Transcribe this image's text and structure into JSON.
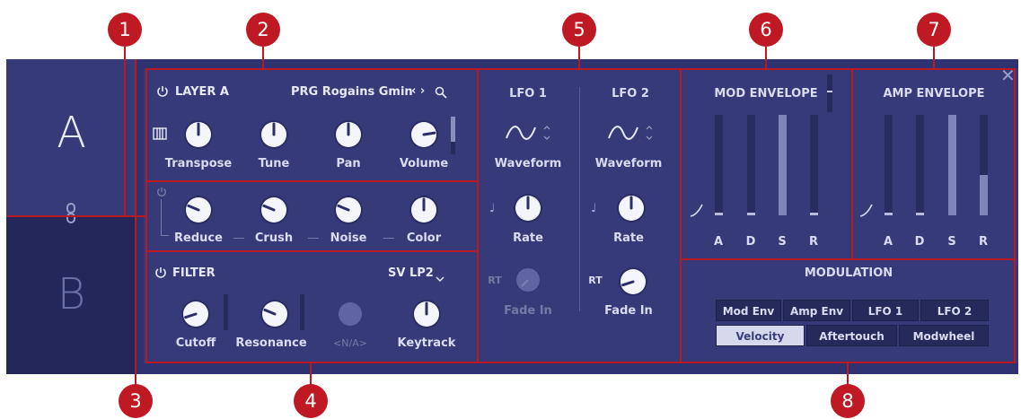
{
  "layers": {
    "a_label": "A",
    "b_label": "B"
  },
  "close_glyph": "✕",
  "callouts": [
    "1",
    "2",
    "3",
    "4",
    "5",
    "6",
    "7",
    "8"
  ],
  "layer_panel": {
    "title": "LAYER A",
    "preset": "PRG Rogains Gmin",
    "knobs": [
      {
        "label": "Transpose",
        "value": 0.5
      },
      {
        "label": "Tune",
        "value": 0.5
      },
      {
        "label": "Pan",
        "value": 0.5
      },
      {
        "label": "Volume",
        "value": 0.8
      }
    ]
  },
  "fx_panel": {
    "knobs": [
      {
        "label": "Reduce",
        "value": 0.25
      },
      {
        "label": "Crush",
        "value": 0.25
      },
      {
        "label": "Noise",
        "value": 0.25
      },
      {
        "label": "Color",
        "value": 0.5
      }
    ]
  },
  "filter_panel": {
    "title": "FILTER",
    "type": "SV LP2",
    "knobs": [
      {
        "label": "Cutoff",
        "value": 0.1
      },
      {
        "label": "Resonance",
        "value": 0.25
      },
      {
        "label": "<N/A>",
        "value": 0.0
      },
      {
        "label": "Keytrack",
        "value": 0.5
      }
    ]
  },
  "lfo1": {
    "title": "LFO 1",
    "waveform_label": "Waveform",
    "rate_label": "Rate",
    "rt_label": "RT",
    "fade_label": "Fade In"
  },
  "lfo2": {
    "title": "LFO 2",
    "waveform_label": "Waveform",
    "rate_label": "Rate",
    "rt_label": "RT",
    "fade_label": "Fade In"
  },
  "mod_env": {
    "title": "MOD ENVELOPE",
    "labels": [
      "A",
      "D",
      "S",
      "R"
    ],
    "levels": [
      0.0,
      0.0,
      1.0,
      0.0
    ]
  },
  "amp_env": {
    "title": "AMP ENVELOPE",
    "labels": [
      "A",
      "D",
      "S",
      "R"
    ],
    "levels": [
      0.0,
      0.0,
      1.0,
      0.4
    ]
  },
  "modulation": {
    "title": "MODULATION",
    "row1": [
      "Mod Env",
      "Amp Env",
      "LFO 1",
      "LFO 2"
    ],
    "row2": [
      "Velocity",
      "Aftertouch",
      "Modwheel"
    ],
    "selected": "Velocity"
  },
  "colors": {
    "panel": "#363a78",
    "outer": "#2f3270",
    "callout": "#bf1a23"
  }
}
